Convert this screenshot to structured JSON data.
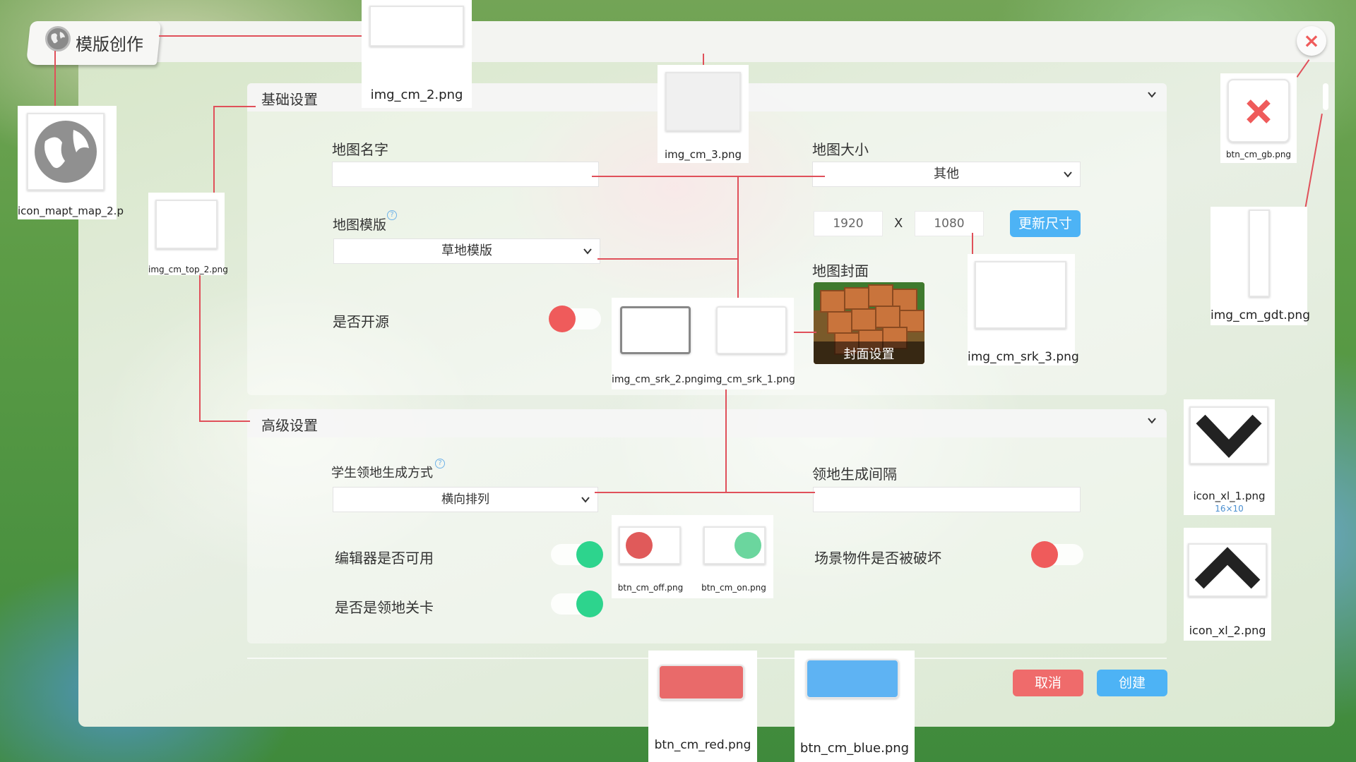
{
  "window": {
    "title": "模版创作",
    "close_icon": "×"
  },
  "colors": {
    "accent_blue": "#4db3f5",
    "accent_red": "#ef6b6b",
    "toggle_on": "#2dd48d",
    "toggle_off": "#ef5b5b",
    "annotation_line": "#e0505a"
  },
  "basic": {
    "header": "基础设置",
    "map_name_label": "地图名字",
    "map_name_value": "",
    "map_size_label": "地图大小",
    "map_size_value": "其他",
    "width_value": "1920",
    "x_sep": "X",
    "height_value": "1080",
    "update_size_button": "更新尺寸",
    "map_template_label": "地图模版",
    "map_template_value": "草地模版",
    "open_source_label": "是否开源",
    "open_source_on": false,
    "cover_label": "地图封面",
    "cover_button": "封面设置"
  },
  "advanced": {
    "header": "高级设置",
    "territory_mode_label": "学生领地生成方式",
    "territory_mode_value": "横向排列",
    "territory_interval_label": "领地生成间隔",
    "territory_interval_value": "",
    "editor_enabled_label": "编辑器是否可用",
    "editor_enabled_on": true,
    "territory_level_label": "是否是领地关卡",
    "territory_level_on": true,
    "scene_destroy_label": "场景物件是否被破坏",
    "scene_destroy_on": false
  },
  "footer": {
    "cancel_button": "取消",
    "create_button": "创建"
  },
  "assets": {
    "icon_map": "icon_mapt_map_2.p",
    "img_cm_2": "img_cm_2.png",
    "img_cm_3": "img_cm_3.png",
    "img_cm_top_2": "img_cm_top_2.png",
    "btn_cm_gb": "btn_cm_gb.png",
    "img_cm_gdt": "img_cm_gdt.png",
    "img_cm_srk_2": "img_cm_srk_2.png",
    "img_cm_srk_1": "img_cm_srk_1.png",
    "img_cm_srk_3": "img_cm_srk_3.png",
    "icon_xl_1": "icon_xl_1.png",
    "icon_xl_1_size": "16×10",
    "icon_xl_2": "icon_xl_2.png",
    "btn_cm_off": "btn_cm_off.png",
    "btn_cm_on": "btn_cm_on.png",
    "btn_cm_red": "btn_cm_red.png",
    "btn_cm_blue": "btn_cm_blue.png"
  }
}
